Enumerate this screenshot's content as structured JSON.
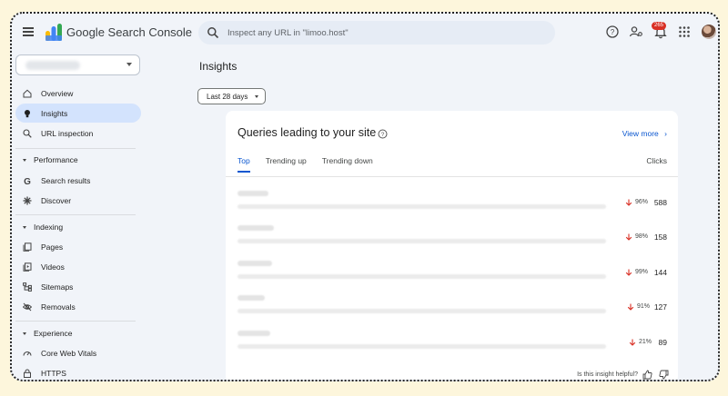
{
  "header": {
    "brand": "Google Search Console",
    "search_placeholder": "Inspect any URL in \"limoo.host\"",
    "notification_count": "265"
  },
  "sidebar": {
    "items": [
      {
        "label": "Overview"
      },
      {
        "label": "Insights"
      },
      {
        "label": "URL inspection"
      }
    ],
    "sections": [
      {
        "label": "Performance",
        "items": [
          {
            "label": "Search results"
          },
          {
            "label": "Discover"
          }
        ]
      },
      {
        "label": "Indexing",
        "items": [
          {
            "label": "Pages"
          },
          {
            "label": "Videos"
          },
          {
            "label": "Sitemaps"
          },
          {
            "label": "Removals"
          }
        ]
      },
      {
        "label": "Experience",
        "items": [
          {
            "label": "Core Web Vitals"
          },
          {
            "label": "HTTPS"
          }
        ]
      }
    ]
  },
  "main": {
    "title": "Insights",
    "date_range": "Last 28 days",
    "card": {
      "title": "Queries leading to your site",
      "view_more": "View more",
      "tabs": [
        "Top",
        "Trending up",
        "Trending down"
      ],
      "column_header": "Clicks",
      "rows": [
        {
          "change": "96%",
          "clicks": "588"
        },
        {
          "change": "98%",
          "clicks": "158"
        },
        {
          "change": "99%",
          "clicks": "144"
        },
        {
          "change": "91%",
          "clicks": "127"
        },
        {
          "change": "21%",
          "clicks": "89"
        }
      ],
      "helpful_prompt": "Is this insight helpful?"
    }
  },
  "colors": {
    "accent": "#0b57d0",
    "active_nav": "#d3e3fd",
    "decline": "#d93025",
    "background": "#f1f4f9"
  }
}
